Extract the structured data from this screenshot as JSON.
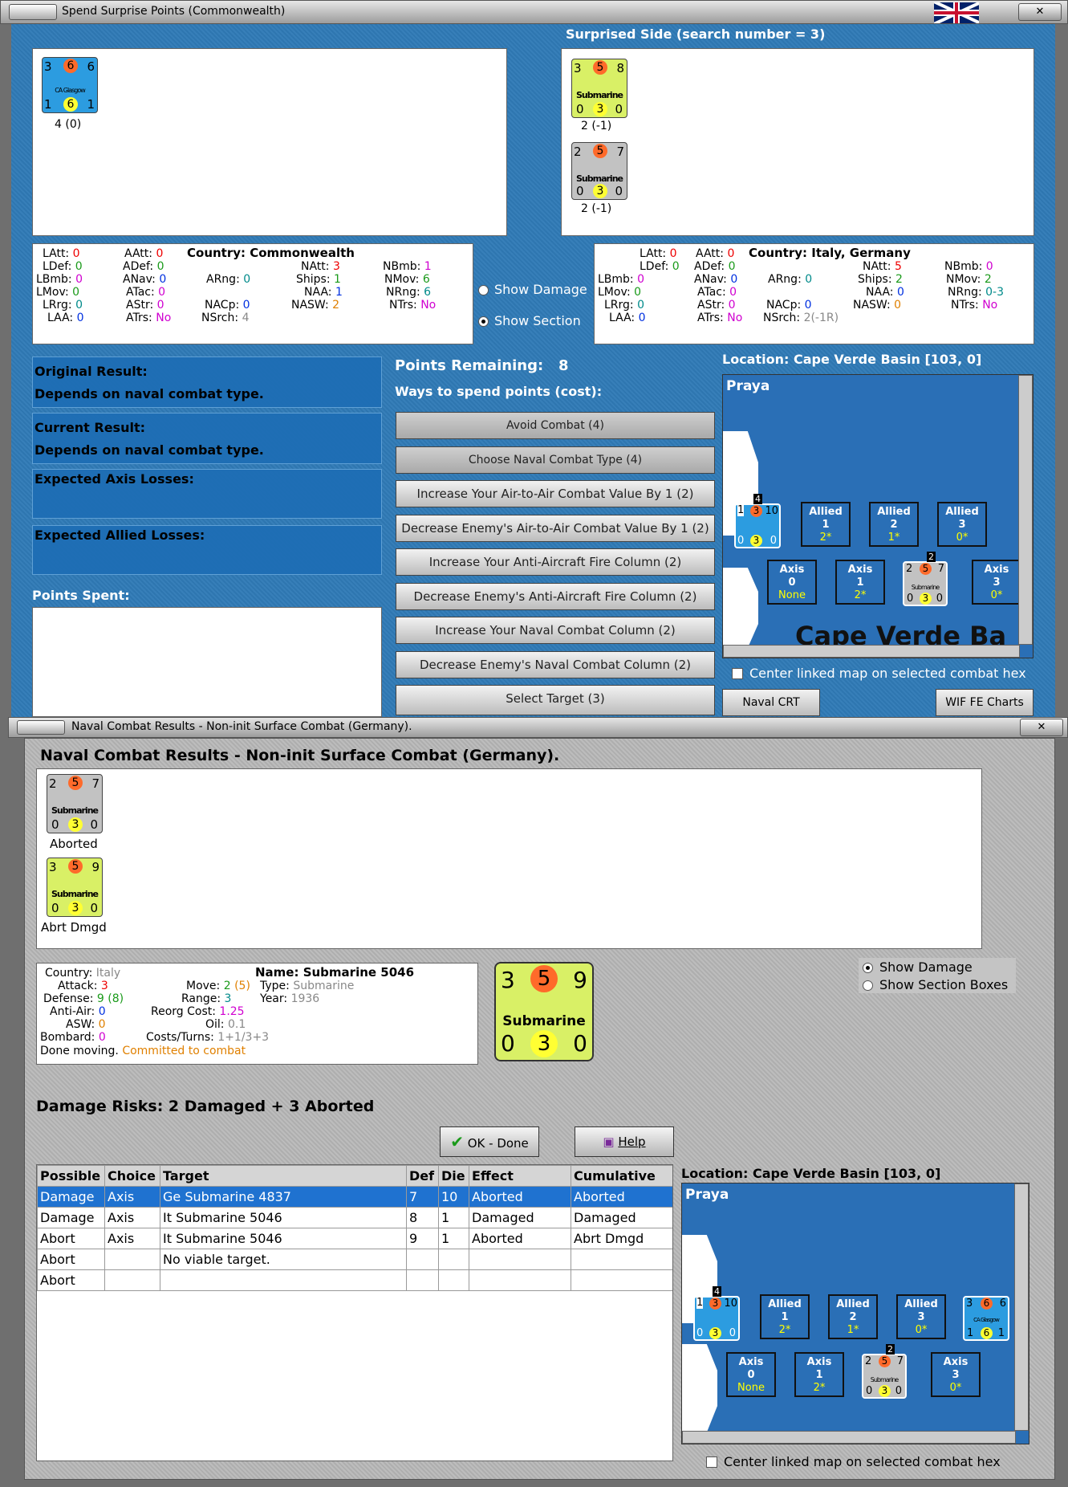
{
  "win1": {
    "title": "Spend Surprise Points (Commonwealth)",
    "surprised_label": "Surprised Side (search number = 3)",
    "left_unit": {
      "att": "3",
      "mid": "6",
      "right": "6",
      "name": "CA Glasgow",
      "b1": "1",
      "b2": "6",
      "b3": "1",
      "caption": "4 (0)"
    },
    "right_units": [
      {
        "att": "3",
        "mid": "5",
        "right": "8",
        "name": "Submarine",
        "b1": "0",
        "b2": "3",
        "b3": "0",
        "caption": "2 (-1)"
      },
      {
        "att": "2",
        "mid": "5",
        "right": "7",
        "name": "Submarine",
        "b1": "0",
        "b2": "3",
        "b3": "0",
        "caption": "2 (-1)"
      }
    ],
    "left_stats": {
      "latt": "LAtt:",
      "latt_v": "0",
      "ldef": "LDef:",
      "ldef_v": "0",
      "lbmb": "LBmb:",
      "lbmb_v": "0",
      "lmov": "LMov:",
      "lmov_v": "0",
      "lrng": "LRrg:",
      "lrng_v": "0",
      "laa": "LAA:",
      "laa_v": "0",
      "aatt": "AAtt:",
      "aatt_v": "0",
      "adef": "ADef:",
      "adef_v": "0",
      "anav": "ANav:",
      "anav_v": "0",
      "atac": "ATac:",
      "atac_v": "0",
      "astr": "AStr:",
      "astr_v": "0",
      "atrs": "ATrs:",
      "atrs_v": "No",
      "country": "Country: Commonwealth",
      "arng": "ARng:",
      "arng_v": "0",
      "nacp": "NACp:",
      "nacp_v": "0",
      "nsrch": "NSrch:",
      "nsrch_v": "4",
      "natt": "NAtt:",
      "natt_v": "3",
      "ships": "Ships:",
      "ships_v": "1",
      "naa": "NAA:",
      "naa_v": "1",
      "nasw": "NASW:",
      "nasw_v": "2",
      "nbmb": "NBmb:",
      "nbmb_v": "1",
      "nmov": "NMov:",
      "nmov_v": "6",
      "nrng": "NRng:",
      "nrng_v": "6",
      "ntrs": "NTrs:",
      "ntrs_v": "No"
    },
    "right_stats": {
      "latt": "LAtt:",
      "latt_v": "0",
      "ldef": "LDef:",
      "ldef_v": "0",
      "lbmb": "LBmb:",
      "lbmb_v": "0",
      "lmov": "LMov:",
      "lmov_v": "0",
      "lrng": "LRrg:",
      "lrng_v": "0",
      "laa": "LAA:",
      "laa_v": "0",
      "aatt": "AAtt:",
      "aatt_v": "0",
      "adef": "ADef:",
      "adef_v": "0",
      "anav": "ANav:",
      "anav_v": "0",
      "atac": "ATac:",
      "atac_v": "0",
      "astr": "AStr:",
      "astr_v": "0",
      "atrs": "ATrs:",
      "atrs_v": "No",
      "country": "Country: Italy, Germany",
      "arng": "ARng:",
      "arng_v": "0",
      "nacp": "NACp:",
      "nacp_v": "0",
      "nsrch": "NSrch:",
      "nsrch_v": "2(-1R)",
      "natt": "NAtt:",
      "natt_v": "5",
      "ships": "Ships:",
      "ships_v": "2",
      "naa": "NAA:",
      "naa_v": "0",
      "nasw": "NASW:",
      "nasw_v": "0",
      "nbmb": "NBmb:",
      "nbmb_v": "0",
      "nmov": "NMov:",
      "nmov_v": "2",
      "nrng": "NRng:",
      "nrng_v": "0-3",
      "ntrs": "NTrs:",
      "ntrs_v": "No"
    },
    "show_damage": "Show Damage",
    "show_section": "Show Section",
    "original_result_label": "Original Result:",
    "original_result": "Depends on naval combat type.",
    "current_result_label": "Current Result:",
    "current_result": "Depends on naval combat type.",
    "axis_losses": "Expected Axis Losses:",
    "allied_losses": "Expected Allied Losses:",
    "points_spent": "Points Spent:",
    "points_remaining_label": "Points Remaining:",
    "points_remaining": "8",
    "ways_label": "Ways to spend points (cost):",
    "buttons": [
      "Avoid Combat (4)",
      "Choose Naval Combat Type (4)",
      "Increase Your Air-to-Air Combat Value By 1 (2)",
      "Decrease Enemy's Air-to-Air Combat Value By 1 (2)",
      "Increase Your Anti-Aircraft Fire Column (2)",
      "Decrease Enemy's Anti-Aircraft Fire Column (2)",
      "Increase Your Naval Combat Column (2)",
      "Decrease Enemy's Naval Combat Column (2)",
      "Select Target (3)"
    ],
    "location": "Location: Cape Verde Basin [103, 0]",
    "map_place": "Praya",
    "map_sea": "Cape Verde Ba",
    "center_linked": "Center linked map on selected combat hex",
    "naval_crt": "Naval CRT",
    "wif_charts": "WIF FE Charts"
  },
  "map_boxes": {
    "allied": [
      {
        "t": "Allied",
        "n": "1",
        "v": "2*"
      },
      {
        "t": "Allied",
        "n": "2",
        "v": "1*"
      },
      {
        "t": "Allied",
        "n": "3",
        "v": "0*"
      }
    ],
    "axis": [
      {
        "t": "Axis",
        "n": "0",
        "v": "None"
      },
      {
        "t": "Axis",
        "n": "1",
        "v": "2*"
      },
      {
        "t": "Axis",
        "n": "3",
        "v": "0*"
      }
    ],
    "stack_top": "4",
    "stack_sub": "2",
    "mini_unit": {
      "a": "1",
      "m": "3",
      "r": "10",
      "b1": "0",
      "b2": "3",
      "b3": "0"
    },
    "mini_sub": {
      "a": "2",
      "m": "5",
      "r": "7",
      "name": "Submarine",
      "b1": "0",
      "b2": "3",
      "b3": "0"
    },
    "mini_ca": {
      "a": "3",
      "m": "6",
      "r": "6",
      "name": "CA Glasgow",
      "b1": "1",
      "b2": "6",
      "b3": "1"
    }
  },
  "win2": {
    "title": "Naval Combat Results - Non-init Surface Combat (Germany).",
    "heading": "Naval Combat Results - Non-init Surface Combat (Germany).",
    "units": [
      {
        "att": "2",
        "mid": "5",
        "right": "7",
        "name": "Submarine",
        "b1": "0",
        "b2": "3",
        "b3": "0",
        "caption": "Aborted"
      },
      {
        "att": "3",
        "mid": "5",
        "right": "9",
        "name": "Submarine",
        "b1": "0",
        "b2": "3",
        "b3": "0",
        "caption": "Abrt Dmgd"
      }
    ],
    "info": {
      "country_l": "Country:",
      "country_v": "Italy",
      "attack_l": "Attack:",
      "attack_v": "3",
      "defense_l": "Defense:",
      "defense_v": "9",
      "defense_v2": "(8)",
      "antiair_l": "Anti-Air:",
      "antiair_v": "0",
      "asw_l": "ASW:",
      "asw_v": "0",
      "bombard_l": "Bombard:",
      "bombard_v": "0",
      "done": "Done moving.",
      "committed": "Committed to combat",
      "name": "Name: Submarine 5046",
      "move_l": "Move:",
      "move_v": "2",
      "move_v2": "(5)",
      "type_l": "Type:",
      "type_v": "Submarine",
      "range_l": "Range:",
      "range_v": "3",
      "year_l": "Year:",
      "year_v": "1936",
      "reorg_l": "Reorg Cost:",
      "reorg_v": "1.25",
      "oil_l": "Oil:",
      "oil_v": "0.1",
      "costs_l": "Costs/Turns:",
      "costs_v": "1+1/3+3"
    },
    "big_unit": {
      "a": "3",
      "m": "5",
      "r": "9",
      "name": "Submarine",
      "b1": "0",
      "b2": "3",
      "b3": "0"
    },
    "show_damage": "Show Damage",
    "show_section_boxes": "Show Section Boxes",
    "damage_risks": "Damage Risks: 2 Damaged + 3 Aborted",
    "ok": "OK - Done",
    "help": "Help",
    "table_headers": [
      "Possible",
      "Choice",
      "Target",
      "Def",
      "Die",
      "Effect",
      "Cumulative"
    ],
    "table_rows": [
      [
        "Damage",
        "Axis",
        "Ge Submarine 4837",
        "7",
        "10",
        "Aborted",
        "Aborted"
      ],
      [
        "Damage",
        "Axis",
        "It Submarine 5046",
        "8",
        "1",
        "Damaged",
        "Damaged"
      ],
      [
        "Abort",
        "Axis",
        "It Submarine 5046",
        "9",
        "1",
        "Aborted",
        "Abrt Dmgd"
      ],
      [
        "Abort",
        "",
        "No viable target.",
        "",
        "",
        "",
        ""
      ],
      [
        "Abort",
        "",
        "",
        "",
        "",
        "",
        ""
      ]
    ],
    "location": "Location:  Cape Verde Basin [103, 0]",
    "map_place": "Praya",
    "center_linked": "Center linked map on selected combat hex"
  },
  "colors": {
    "panel_blue": "#2f7ab6",
    "selection": "#1f72d0",
    "sub_yellow": "#d9f066",
    "sub_grey": "#c2c2c2",
    "ca_blue": "#2c9ce0"
  }
}
